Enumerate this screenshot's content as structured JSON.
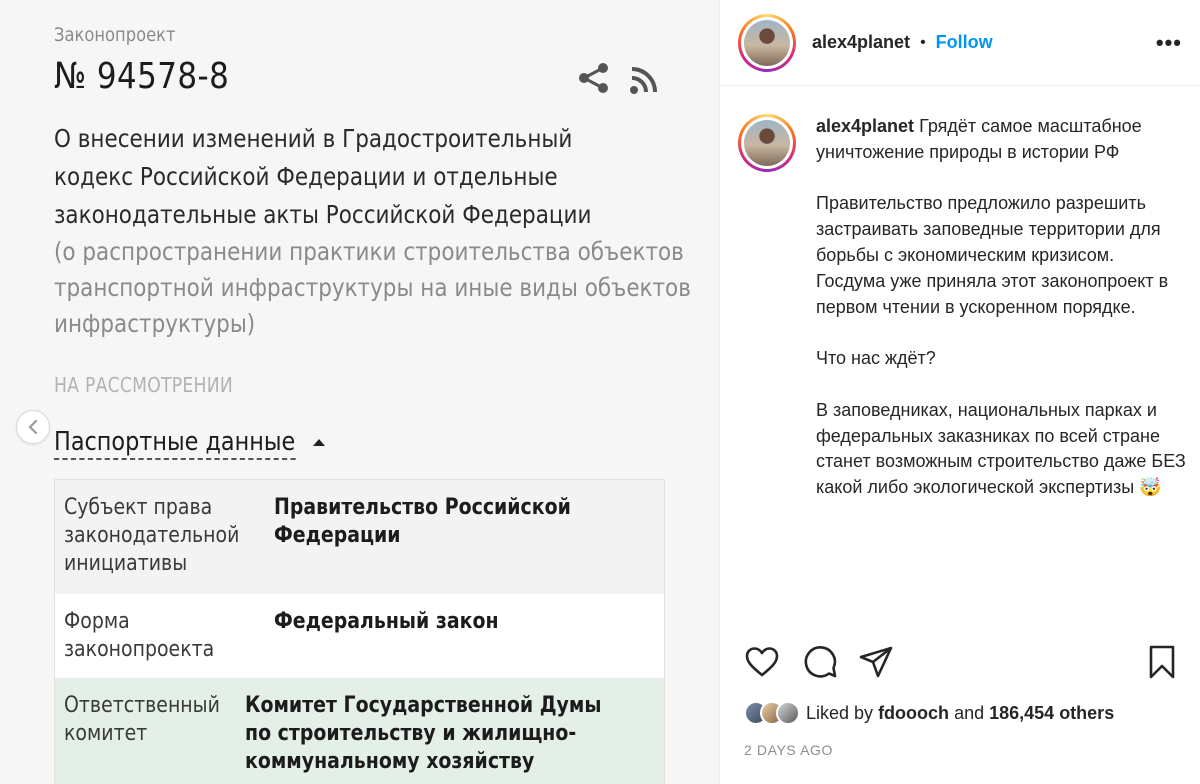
{
  "image": {
    "kicker": "Законопроект",
    "number": "№ 94578-8",
    "title_lines": [
      "О внесении изменений в Градостроительный",
      "кодекс Российской Федерации и отдельные",
      "законодательные акты Российской Федерации"
    ],
    "subtitle_lines": [
      "(о распространении практики строительства объектов",
      "транспортной инфраструктуры на иные виды объектов",
      "инфраструктуры)"
    ],
    "status": "НА РАССМОТРЕНИИ",
    "passport_heading": "Паспортные данные",
    "table": [
      {
        "key_lines": [
          "Субъект права",
          "законодательной",
          "инициативы"
        ],
        "value_lines": [
          "Правительство Российской",
          "Федерации"
        ]
      },
      {
        "key_lines": [
          "Форма",
          "законопроекта"
        ],
        "value_lines": [
          "Федеральный закон"
        ]
      },
      {
        "key_lines": [
          "Ответственный",
          "комитет"
        ],
        "value_lines": [
          "Комитет Государственной Думы",
          "по строительству и жилищно-",
          "коммунальному хозяйству"
        ]
      }
    ]
  },
  "post": {
    "username": "alex4planet",
    "dot": "•",
    "follow_label": "Follow",
    "more_label": "•••",
    "caption_paragraphs": [
      "Грядёт самое масштабное уничтожение природы в истории РФ",
      "Правительство предложило разрешить застраивать заповедные территории для борьбы с экономическим кризисом. Госдума уже приняла этот законопроект в первом чтении в ускоренном порядке.",
      "Что нас ждёт?",
      "В заповедниках, национальных парках и федеральных заказниках по всей стране станет возможным строительство даже БЕЗ какой либо экологической экспертизы 🤯"
    ],
    "liked_prefix": "Liked by",
    "liked_user": "fdoooch",
    "liked_and": "and",
    "liked_count": "186,454 others",
    "timestamp": "2 DAYS AGO"
  },
  "icons": {
    "share": "share-icon",
    "rss": "rss-icon",
    "like": "heart-icon",
    "comment": "comment-icon",
    "send": "send-icon",
    "save": "bookmark-icon",
    "prev": "chevron-left-icon"
  },
  "colors": {
    "follow": "#0095f6",
    "table_highlight": "#e4efe8"
  }
}
